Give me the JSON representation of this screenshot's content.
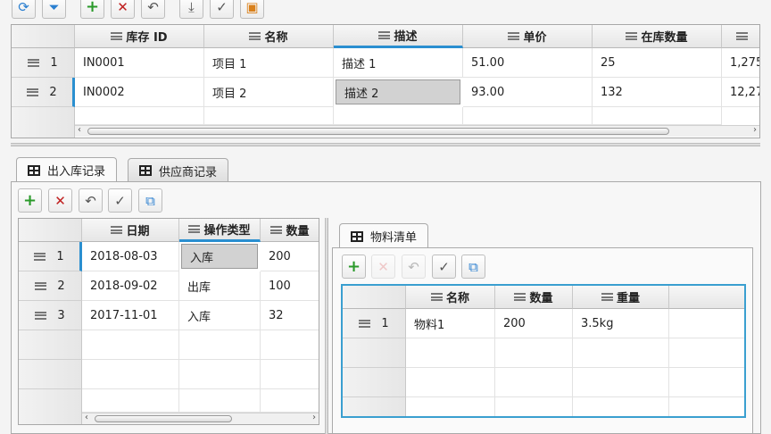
{
  "toolbar_icons": [
    "refresh-icon",
    "filter-icon",
    "add-icon",
    "delete-icon",
    "undo-icon",
    "download-icon",
    "check-circle-icon",
    "save-icon"
  ],
  "inventory": {
    "columns": [
      "库存 ID",
      "名称",
      "描述",
      "单价",
      "在库数量",
      ""
    ],
    "rows": [
      {
        "num": "1",
        "cells": [
          "IN0001",
          "项目 1",
          "描述 1",
          "51.00",
          "25",
          "1,275"
        ]
      },
      {
        "num": "2",
        "cells": [
          "IN0002",
          "项目 2",
          "描述 2",
          "93.00",
          "132",
          "12,27"
        ]
      }
    ]
  },
  "tabs": {
    "records": "出入库记录",
    "suppliers": "供应商记录",
    "materials": "物料清单"
  },
  "records": {
    "columns": [
      "日期",
      "操作类型",
      "数量"
    ],
    "rows": [
      {
        "num": "1",
        "cells": [
          "2018-08-03",
          "入库",
          "200"
        ]
      },
      {
        "num": "2",
        "cells": [
          "2018-09-02",
          "出库",
          "100"
        ]
      },
      {
        "num": "3",
        "cells": [
          "2017-11-01",
          "入库",
          "32"
        ]
      }
    ]
  },
  "materials": {
    "columns": [
      "名称",
      "数量",
      "重量",
      ""
    ],
    "rows": [
      {
        "num": "1",
        "cells": [
          "物料1",
          "200",
          "3.5kg",
          ""
        ]
      }
    ]
  },
  "colors": {
    "accent": "#2a8fd0",
    "add": "#2a9a2a",
    "delete": "#c02020"
  }
}
